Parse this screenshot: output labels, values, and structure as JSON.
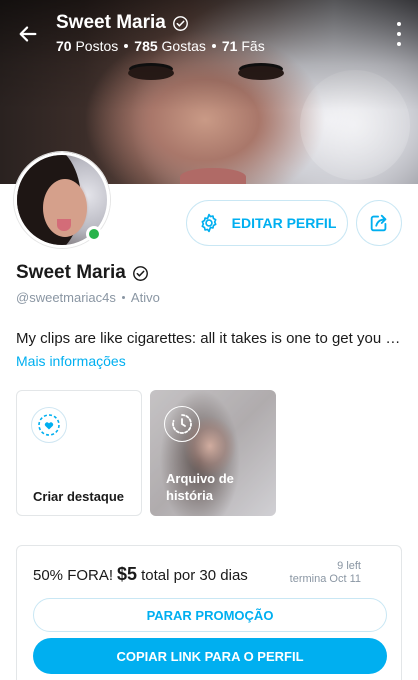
{
  "header": {
    "name": "Sweet Maria",
    "posts": "70",
    "posts_label": "Postos",
    "likes": "785",
    "likes_label": "Gostas",
    "fans": "71",
    "fans_label": "Fãs"
  },
  "actions": {
    "edit_label": "EDITAR PERFIL"
  },
  "profile": {
    "name": "Sweet Maria",
    "handle": "@sweetmariac4s",
    "status": "Ativo",
    "bio": "My clips are like cigarettes: all it takes is one to get you hooked…",
    "more_link": "Mais informações"
  },
  "highlights": {
    "create_label": "Criar destaque",
    "archive_label": "Arquivo de história"
  },
  "promo": {
    "discount": "50% FORA!",
    "price": "$5",
    "period": "total por 30 dias",
    "left": "9 left",
    "ends": "termina Oct 11",
    "stop_label": "PARAR PROMOÇÃO",
    "copy_label": "COPIAR LINK PARA O PERFIL"
  },
  "colors": {
    "accent": "#00aff0",
    "online": "#28b34b",
    "muted": "#8a96a3"
  },
  "icons": {
    "back": "arrow-left-icon",
    "verified": "verified-check-icon",
    "menu": "more-vertical-icon",
    "settings": "gear-icon",
    "share": "share-icon",
    "highlight": "heart-badge-icon",
    "archive": "history-clock-icon"
  }
}
